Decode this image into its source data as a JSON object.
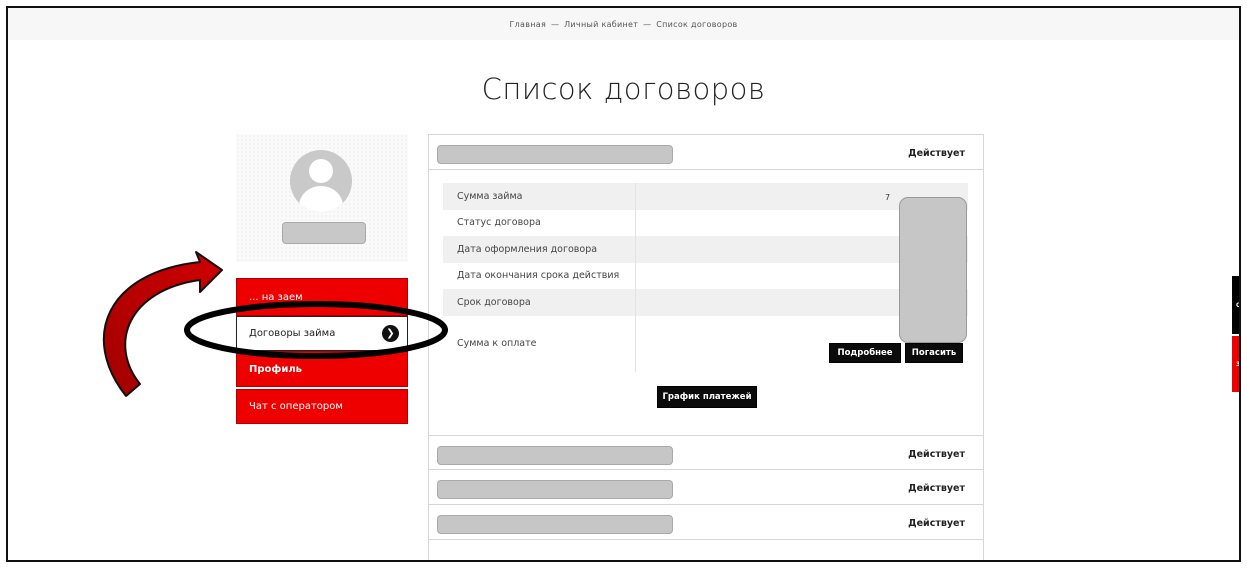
{
  "breadcrumbs": {
    "home": "Главная",
    "sep1": "—",
    "account": "Личный кабинет",
    "sep2": "—",
    "current": "Список договоров"
  },
  "page_title": "Список договоров",
  "sidebar": {
    "items": [
      {
        "label": "... на заем",
        "state": "red"
      },
      {
        "label": "Договоры займа",
        "state": "active"
      },
      {
        "label": "Профиль",
        "state": "red"
      },
      {
        "label": "Чат с оператором",
        "state": "red"
      }
    ],
    "arrow_icon": "chevron-right-icon"
  },
  "contracts": [
    {
      "status": "Действует",
      "expanded": true
    },
    {
      "status": "Действует",
      "expanded": false
    },
    {
      "status": "Действует",
      "expanded": false
    },
    {
      "status": "Действует",
      "expanded": false
    }
  ],
  "details": {
    "rows": [
      {
        "label": "Сумма займа"
      },
      {
        "label": "Статус договора"
      },
      {
        "label": "Дата оформления договора"
      },
      {
        "label": "Дата окончания срока действия"
      },
      {
        "label": "Срок договора"
      },
      {
        "label": "Сумма к оплате"
      }
    ],
    "value_fragment": "7",
    "more_button": "Подробнее",
    "repay_button": "Погасить",
    "schedule_button": "График платежей"
  },
  "right_widgets": [
    {
      "label": "О",
      "color": "#000000"
    },
    {
      "label": "З",
      "color": "#ee0000"
    }
  ],
  "colors": {
    "accent_red": "#ee0000",
    "annotation_red": "#c00000",
    "button_black": "#0b0b0b"
  }
}
